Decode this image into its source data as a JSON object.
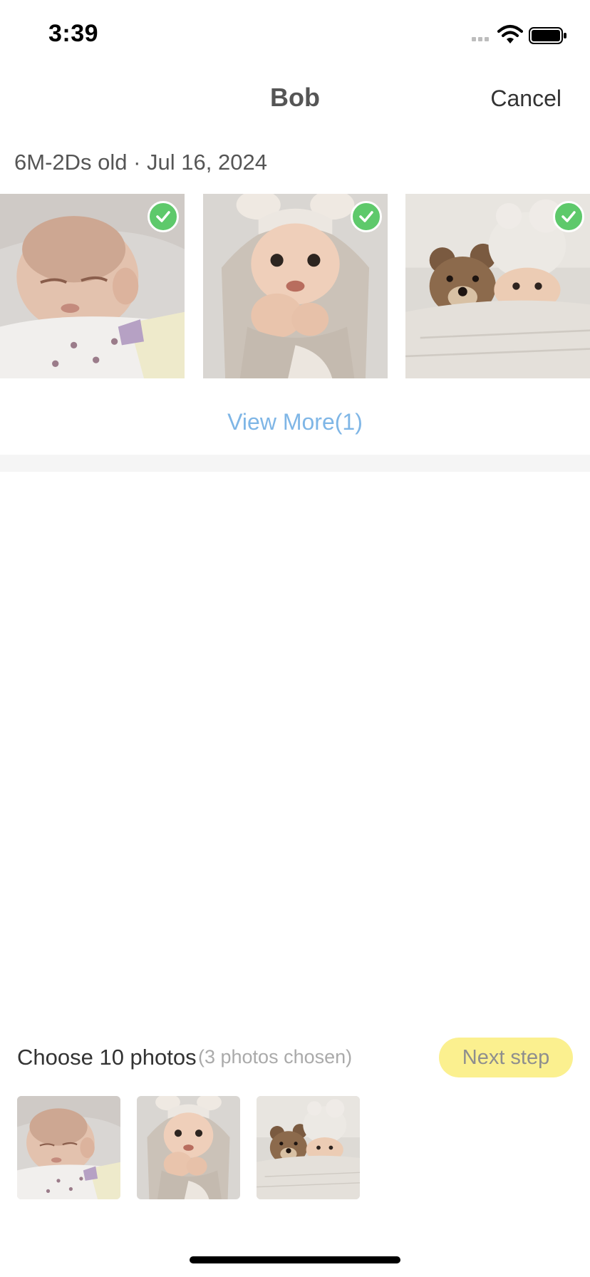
{
  "status_bar": {
    "time": "3:39",
    "icons": [
      "signal-icon",
      "wifi-icon",
      "battery-icon"
    ]
  },
  "nav": {
    "title": "Bob",
    "cancel_label": "Cancel"
  },
  "group": {
    "header": "6M-2Ds old · Jul 16, 2024",
    "photos": [
      {
        "subject": "sleeping newborn in white blanket",
        "selected": true
      },
      {
        "subject": "baby in bear-ear hoodie",
        "selected": true
      },
      {
        "subject": "baby in knit hat beside teddy bear",
        "selected": true
      }
    ],
    "view_more_label": "View More(1)"
  },
  "selection": {
    "title": "Choose 10 photos",
    "count_label": "(3 photos chosen)",
    "next_label": "Next step",
    "thumbnails": [
      {
        "subject": "sleeping newborn in white blanket"
      },
      {
        "subject": "baby in bear-ear hoodie"
      },
      {
        "subject": "baby in knit hat beside teddy bear"
      }
    ]
  },
  "colors": {
    "check_green": "#5ec96b",
    "link_blue": "#7fb6e6",
    "next_button_yellow": "#fbf08f"
  }
}
